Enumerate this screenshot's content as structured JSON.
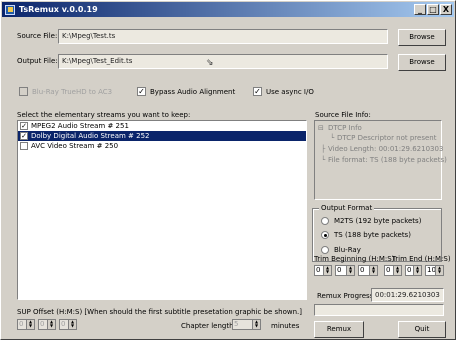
{
  "window": {
    "title": "TsRemux v.0.0.19",
    "controls": {
      "minimize": "_",
      "maximize": "□",
      "close": "X"
    }
  },
  "source": {
    "label": "Source File:",
    "value": "K:\\Mpeg\\Test.ts",
    "browse": "Browse"
  },
  "output": {
    "label": "Output File:",
    "value": "K:\\Mpeg\\Test_Edit.ts",
    "browse": "Browse"
  },
  "options": {
    "bluray_truehd": {
      "label": "Blu-Ray TrueHD to AC3",
      "checked": false,
      "enabled": false
    },
    "bypass_audio": {
      "label": "Bypass Audio Alignment",
      "checked": true
    },
    "use_async": {
      "label": "Use async I/O",
      "checked": true
    }
  },
  "streams": {
    "label": "Select the elementary streams you want to keep:",
    "items": [
      {
        "label": "MPEG2 Audio Stream # 251",
        "checked": true,
        "selected": false
      },
      {
        "label": "Dolby Digital Audio Stream # 252",
        "checked": true,
        "selected": true
      },
      {
        "label": "AVC Video Stream # 250",
        "checked": false,
        "selected": false
      }
    ]
  },
  "source_info": {
    "label": "Source File Info:",
    "dtcp_info": "DTCP Info",
    "dtcp_descriptor": "DTCP Descriptor not present",
    "video_length": "Video Length: 00:01:29.6210303",
    "file_format": "File format: TS (188 byte packets)"
  },
  "output_format": {
    "label": "Output Format",
    "options": [
      {
        "label": "M2TS (192 byte packets)",
        "selected": false
      },
      {
        "label": "TS (188 byte packets)",
        "selected": true
      },
      {
        "label": "Blu-Ray",
        "selected": false
      }
    ]
  },
  "trim": {
    "begin_label": "Trim Beginning (H:M:S)",
    "end_label": "Trim End (H:M:S)",
    "begin": [
      "0",
      "0",
      "0"
    ],
    "end": [
      "0",
      "0",
      "10"
    ]
  },
  "progress": {
    "label": "Remux Progress:",
    "value": "00:01:29.6210303"
  },
  "sup_offset": {
    "label": "SUP Offset (H:M:S) [When should the first subtitle presetation graphic be shown.]",
    "values": [
      "0",
      "0",
      "0"
    ]
  },
  "chapter": {
    "label": "Chapter length:",
    "value": "5",
    "unit": "minutes"
  },
  "buttons": {
    "remux": "Remux",
    "quit": "Quit"
  },
  "colors": {
    "titlebar_start": "#0a246a",
    "titlebar_end": "#a6caf0",
    "selection": "#0a246a",
    "dialog": "#d4d0c8",
    "background": "#7fb86f"
  }
}
